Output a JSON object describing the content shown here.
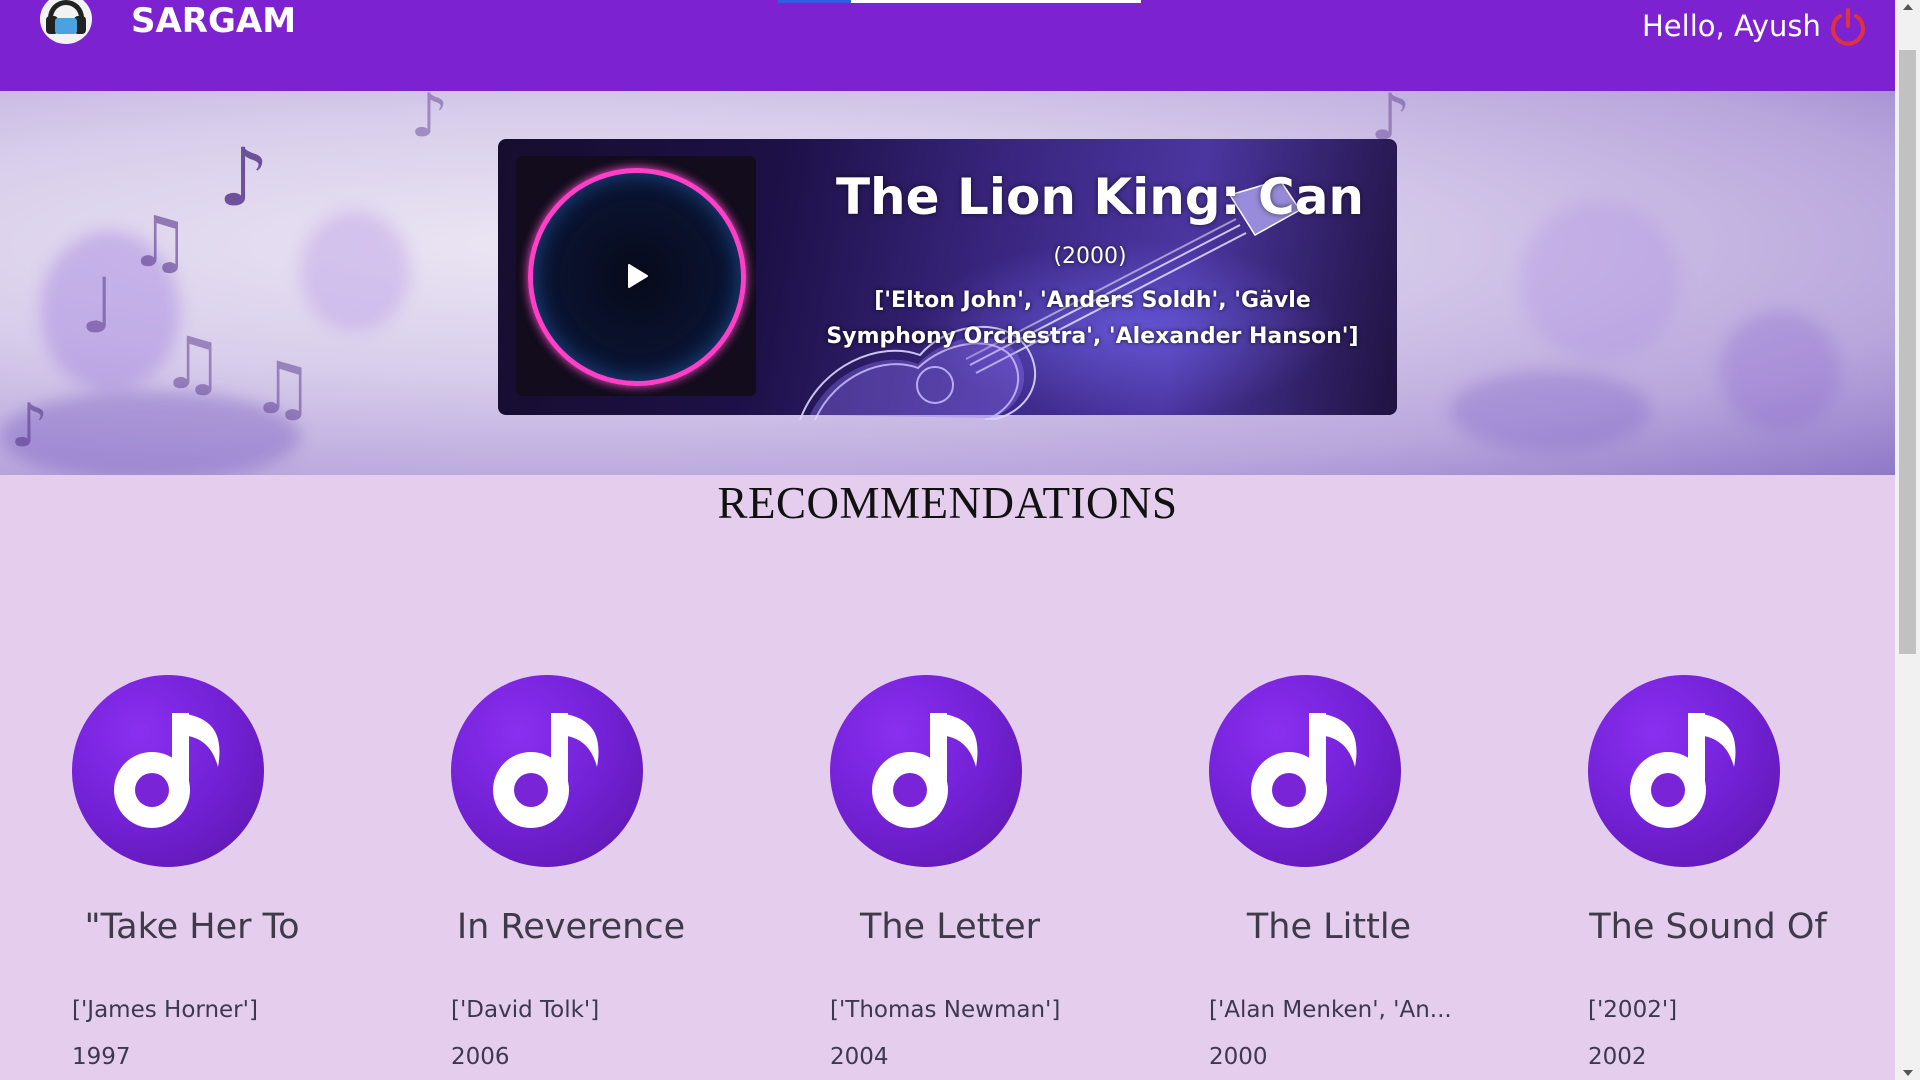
{
  "app": {
    "brand": "SARGAM",
    "greeting": "Hello, Ayush"
  },
  "colors": {
    "header": "#7d22d0",
    "background": "#e5cdee",
    "accent_power": "#e0323c",
    "disc": "#7422d8"
  },
  "icons": {
    "logo": "headphones-logo-icon",
    "power": "power-icon",
    "play": "play-icon",
    "note": "music-note-icon"
  },
  "now_playing": {
    "title": "The Lion King: Can",
    "year": "(2000)",
    "artists": "['Elton John', 'Anders Soldh', 'Gävle Symphony Orchestra', 'Alexander Hanson']"
  },
  "recommendations": {
    "heading": "RECOMMENDATIONS",
    "items": [
      {
        "title": "\"Take Her To",
        "artist": "['James Horner']",
        "year": "1997"
      },
      {
        "title": "In Reverence",
        "artist": "['David Tolk']",
        "year": "2006"
      },
      {
        "title": "The Letter",
        "artist": "['Thomas Newman']",
        "year": "2004"
      },
      {
        "title": "The Little",
        "artist": "['Alan Menken', 'An...",
        "year": "2000"
      },
      {
        "title": "The Sound Of",
        "artist": "['2002']",
        "year": "2002"
      }
    ]
  }
}
